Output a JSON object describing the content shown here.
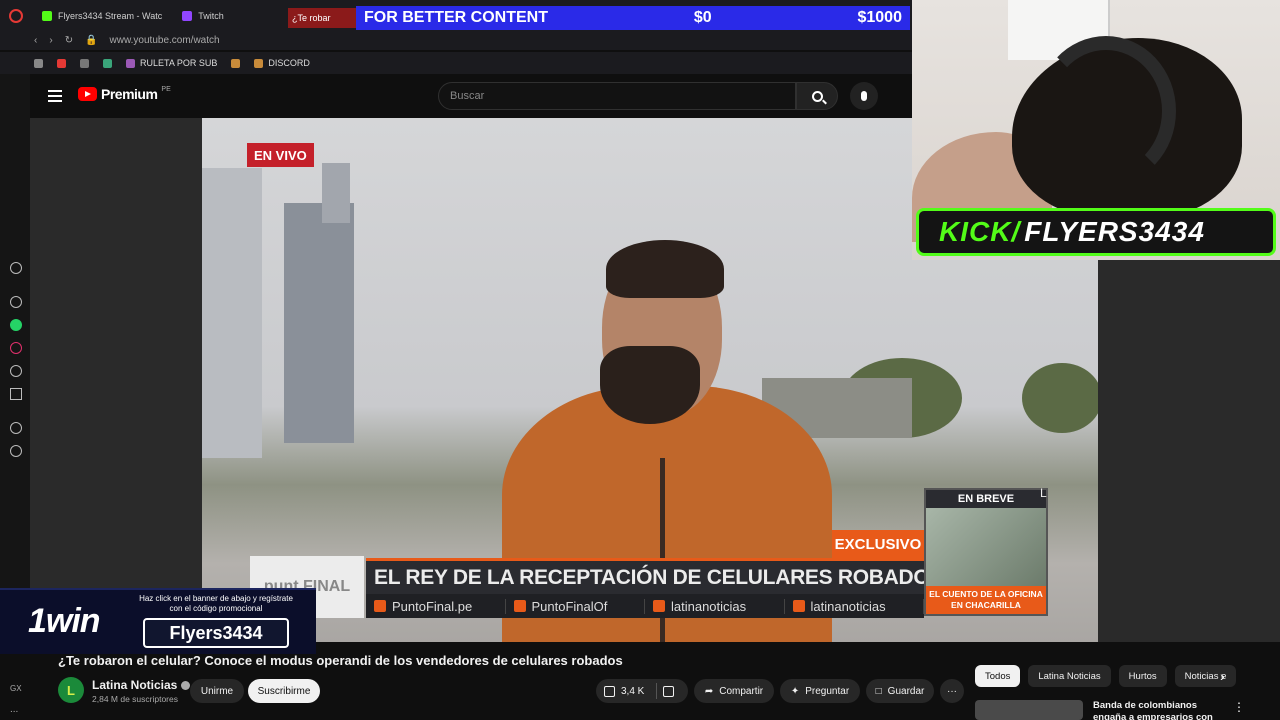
{
  "browser": {
    "tabs": [
      {
        "label": "Flyers3434 Stream - Watc",
        "color": "#53fc18"
      },
      {
        "label": "Twitch",
        "color": "#9146ff"
      },
      {
        "label": "¿Te robar",
        "color": "#e53935"
      }
    ],
    "url": "www.youtube.com/watch",
    "bookmarks": [
      "RULETA POR SUB",
      "DISCORD"
    ]
  },
  "youtube": {
    "brand": "Premium",
    "region": "PE",
    "search_placeholder": "Buscar"
  },
  "donation": {
    "label": "FOR BETTER CONTENT",
    "current": "$0",
    "goal": "$1000"
  },
  "overlay": {
    "kick_prefix": "KICK/",
    "kick_name": "FLYERS3434",
    "win_logo": "1win",
    "win_hint": "Haz click en el banner de abajo  y regístrate con el código promocional",
    "win_code": "Flyers3434"
  },
  "video": {
    "live_badge": "EN VIVO",
    "exclusive": "EXCLUSIVO",
    "brand_box": "punt FINAL",
    "headline": "EL REY DE LA RECEPTACIÓN DE CELULARES ROBADOS",
    "socials": [
      "PuntoFinal.pe",
      "PuntoFinalOf",
      "latinanoticias",
      "latinanoticias"
    ],
    "breve_title": "EN BREVE",
    "breve_caption": "EL CUENTO DE LA OFICINA EN CHACARILLA",
    "watermark": "L"
  },
  "watch": {
    "title": "¿Te robaron el celular? Conoce el modus operandi de los vendedores de celulares robados",
    "channel": "Latina Noticias",
    "avatar_letter": "L",
    "subscribers": "2,84 M de suscriptores",
    "join": "Unirme",
    "subscribe": "Suscribirme",
    "likes": "3,4 K",
    "share": "Compartir",
    "ask": "Preguntar",
    "save": "Guardar",
    "more": "···"
  },
  "sidebar_chips": [
    "Todos",
    "Latina Noticias",
    "Hurtos",
    "Noticias e"
  ],
  "recommendation": {
    "title": "Banda de colombianos engaña a empresarios con el cuento d"
  },
  "corner": {
    "zoom": "GX",
    "dots": "..."
  }
}
